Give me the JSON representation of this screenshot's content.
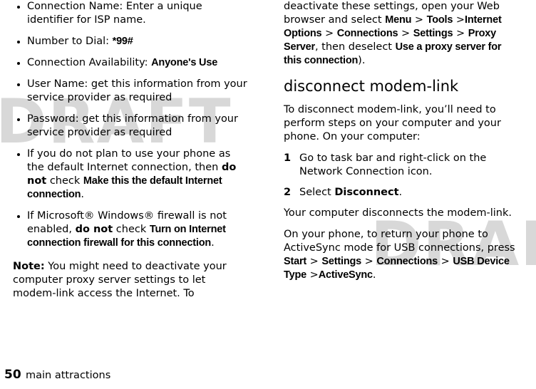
{
  "page": {
    "folio": "50",
    "footer_title": "main attractions",
    "watermark": "DRAFT"
  },
  "left_column": {
    "bullets": [
      {
        "parts": [
          {
            "text": "Connection Name: Enter a unique identifier for ISP name.",
            "style": "normal"
          }
        ]
      },
      {
        "parts": [
          {
            "text": "Number to Dial: ",
            "style": "normal"
          },
          {
            "text": "*99#",
            "style": "narrow"
          }
        ]
      },
      {
        "parts": [
          {
            "text": "Connection Availability: ",
            "style": "normal"
          },
          {
            "text": "Anyone's Use",
            "style": "narrow"
          }
        ]
      },
      {
        "parts": [
          {
            "text": "User Name: get this information from your service provider as required",
            "style": "normal"
          }
        ]
      },
      {
        "parts": [
          {
            "text": "Password: get this information from your service provider as required",
            "style": "normal"
          }
        ]
      },
      {
        "parts": [
          {
            "text": "If you do not plan to use your phone as the default Internet connection, then ",
            "style": "normal"
          },
          {
            "text": "do not",
            "style": "bold"
          },
          {
            "text": " check ",
            "style": "normal"
          },
          {
            "text": "Make this the default Internet connection",
            "style": "narrow"
          },
          {
            "text": ".",
            "style": "normal"
          }
        ]
      },
      {
        "parts": [
          {
            "text": "If Microsoft® Windows® firewall is not enabled, ",
            "style": "normal"
          },
          {
            "text": "do not",
            "style": "bold"
          },
          {
            "text": " check ",
            "style": "normal"
          },
          {
            "text": "Turn on Internet connection firewall for this connection",
            "style": "narrow"
          },
          {
            "text": ".",
            "style": "normal"
          }
        ]
      }
    ],
    "note": {
      "label": "Note:",
      "text": " You might need to deactivate your computer proxy server settings to let modem-link access the Internet. To"
    }
  },
  "right_column": {
    "intro": {
      "parts": [
        {
          "text": "deactivate these settings, open your Web browser and select ",
          "style": "normal"
        },
        {
          "text": "Menu",
          "style": "narrow"
        },
        {
          "text": " > ",
          "style": "normal"
        },
        {
          "text": "Tools",
          "style": "narrow"
        },
        {
          "text": " >",
          "style": "normal"
        },
        {
          "text": "Internet Options",
          "style": "narrow"
        },
        {
          "text": " > ",
          "style": "normal"
        },
        {
          "text": "Connections",
          "style": "narrow"
        },
        {
          "text": " > ",
          "style": "normal"
        },
        {
          "text": "Settings",
          "style": "narrow"
        },
        {
          "text": " > ",
          "style": "normal"
        },
        {
          "text": "Proxy Server",
          "style": "narrow"
        },
        {
          "text": ", then deselect ",
          "style": "normal"
        },
        {
          "text": "Use a proxy server for this connection",
          "style": "narrow"
        },
        {
          "text": ").",
          "style": "normal"
        }
      ]
    },
    "heading": "disconnect modem-link",
    "paragraph1": "To disconnect modem-link, you’ll need to perform steps on your computer and your phone. On your computer:",
    "steps": [
      {
        "num": "1",
        "parts": [
          {
            "text": "Go to task bar and right-click on the Network Connection icon.",
            "style": "normal"
          }
        ]
      },
      {
        "num": "2",
        "parts": [
          {
            "text": "Select ",
            "style": "normal"
          },
          {
            "text": "Disconnect",
            "style": "bold"
          },
          {
            "text": ".",
            "style": "normal"
          }
        ]
      }
    ],
    "paragraph2": "Your computer disconnects the modem-link.",
    "paragraph3": {
      "parts": [
        {
          "text": "On your phone, to return your phone to ActiveSync mode for USB connections, press ",
          "style": "normal"
        },
        {
          "text": "Start",
          "style": "narrow"
        },
        {
          "text": " > ",
          "style": "normal"
        },
        {
          "text": "Settings",
          "style": "narrow"
        },
        {
          "text": " > ",
          "style": "normal"
        },
        {
          "text": "Connections",
          "style": "narrow"
        },
        {
          "text": " > ",
          "style": "normal"
        },
        {
          "text": "USB Device Type",
          "style": "narrow"
        },
        {
          "text": " >",
          "style": "normal"
        },
        {
          "text": "ActiveSync",
          "style": "narrow"
        },
        {
          "text": ".",
          "style": "normal"
        }
      ]
    }
  }
}
